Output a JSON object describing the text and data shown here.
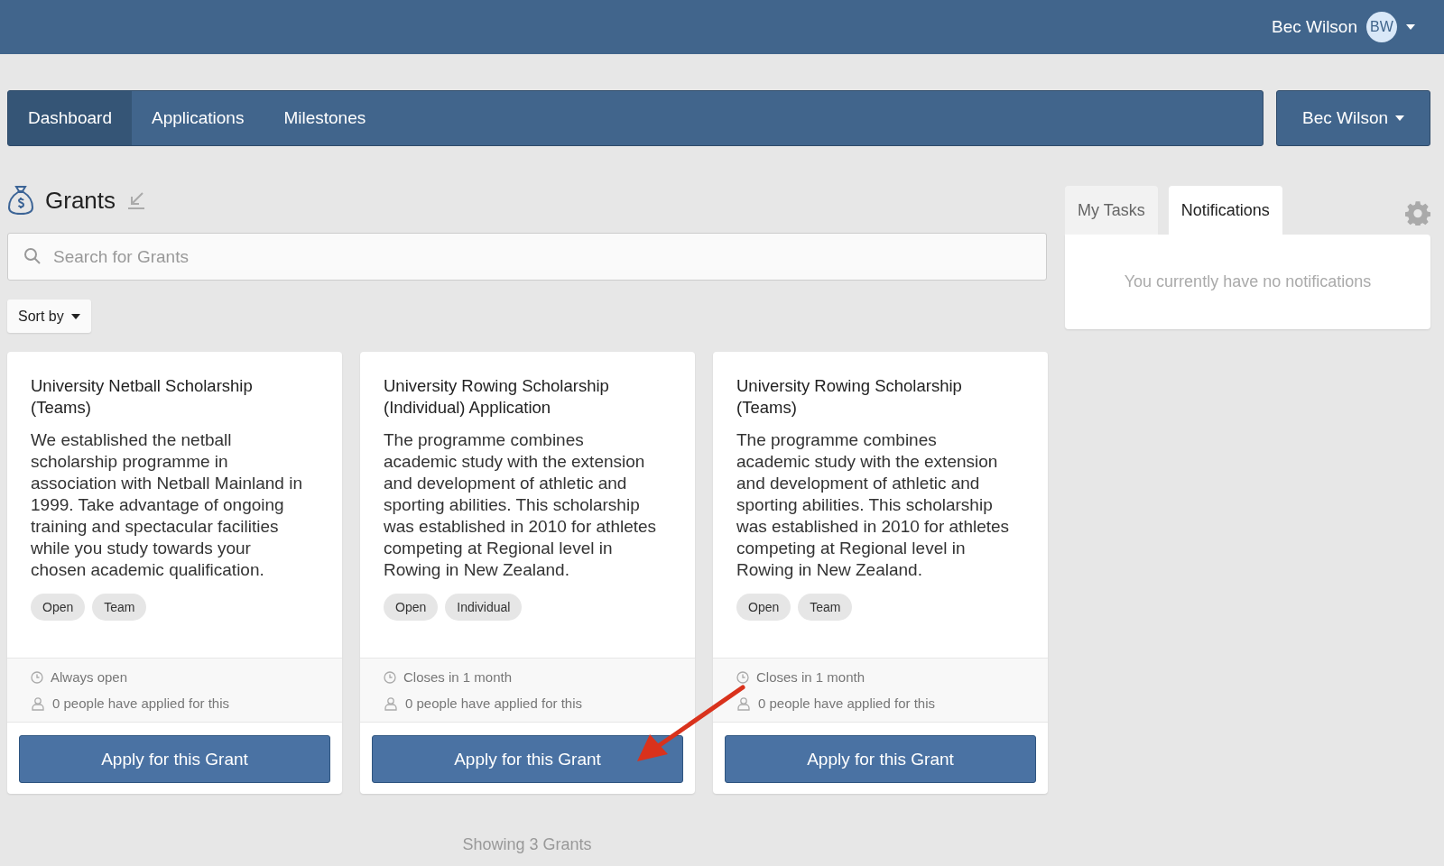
{
  "top_bar": {
    "user_name": "Bec Wilson",
    "avatar_initials": "BW"
  },
  "nav": {
    "tabs": [
      {
        "label": "Dashboard",
        "selected": true
      },
      {
        "label": "Applications",
        "selected": false
      },
      {
        "label": "Milestones",
        "selected": false
      }
    ],
    "user_menu": "Bec Wilson"
  },
  "heading": "Grants",
  "search": {
    "placeholder": "Search for Grants"
  },
  "sort": {
    "label": "Sort by"
  },
  "grants": [
    {
      "title": "University Netball Scholarship (Teams)",
      "description": "We established the netball scholarship programme in association with Netball Mainland in 1999. Take advantage of ongoing training and spectacular facilities while you study towards your chosen academic qualification.",
      "tags": [
        "Open",
        "Team"
      ],
      "deadline": "Always open",
      "applicants": "0 people have applied for this",
      "button": "Apply for this Grant"
    },
    {
      "title": "University Rowing Scholarship (Individual) Application",
      "description": "The programme combines academic study with the extension and development of athletic and sporting abilities. This scholarship was established in 2010 for athletes competing at Regional level in Rowing in New Zealand.",
      "tags": [
        "Open",
        "Individual"
      ],
      "deadline": "Closes in 1 month",
      "applicants": "0 people have applied for this",
      "button": "Apply for this Grant"
    },
    {
      "title": "University Rowing Scholarship (Teams)",
      "description": "The programme combines academic study with the extension and development of athletic and sporting abilities. This scholarship was established in 2010 for athletes competing at Regional level in Rowing in New Zealand.",
      "tags": [
        "Open",
        "Team"
      ],
      "deadline": "Closes in 1 month",
      "applicants": "0 people have applied for this",
      "button": "Apply for this Grant"
    }
  ],
  "footer": "Showing 3 Grants",
  "side_panel": {
    "tabs": [
      {
        "label": "My Tasks",
        "selected": false
      },
      {
        "label": "Notifications",
        "selected": true
      }
    ],
    "empty_message": "You currently have no notifications"
  }
}
